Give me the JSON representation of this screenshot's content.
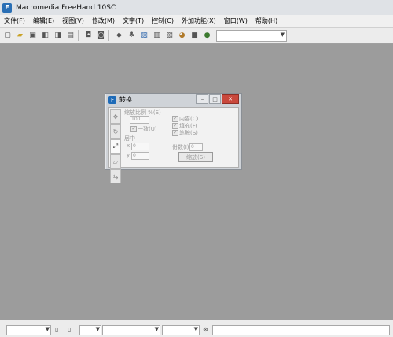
{
  "window": {
    "title": "Macromedia FreeHand 10SC"
  },
  "menu": [
    "文件(F)",
    "编辑(E)",
    "视图(V)",
    "修改(M)",
    "文字(T)",
    "控制(C)",
    "外加功能(X)",
    "窗口(W)",
    "帮助(H)"
  ],
  "toolbar": {
    "icons": [
      "new-icon",
      "open-icon",
      "save-icon",
      "import-icon",
      "export-icon",
      "print-icon",
      "lock-icon",
      "unlock-icon",
      "layer-icon",
      "symbol-icon",
      "color-icon",
      "library-icon",
      "style-icon",
      "swatch-icon",
      "fill-icon",
      "stroke-icon"
    ],
    "combo_value": ""
  },
  "panel": {
    "title": "转换",
    "scale_label": "缩放比例 %(S)",
    "scale_value": "100",
    "uniform_label": "一致(U)",
    "center_label": "居中",
    "x_label": "x",
    "x_value": "0",
    "y_label": "y",
    "y_value": "0",
    "contents_label": "内容(C)",
    "fills_label": "填充(F)",
    "strokes_label": "笔触(S)",
    "copies_label": "份数(I)",
    "copies_value": "0",
    "scale_button": "缩放(S)"
  },
  "statusbar": {
    "combo1": "",
    "combo2": "",
    "combo3": "",
    "combo4": "",
    "field": ""
  }
}
